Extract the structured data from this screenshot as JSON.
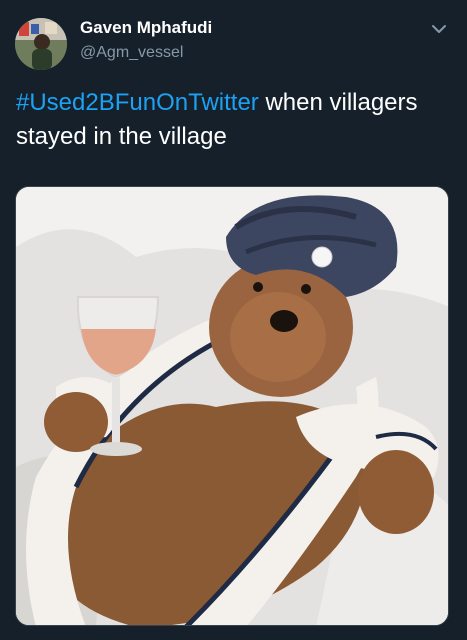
{
  "tweet": {
    "author_name": "Gaven Mphafudi",
    "author_handle": "@Agm_vessel",
    "hashtag": "#Used2BFunOnTwitter",
    "text": " when villagers stayed in the village"
  },
  "icons": {
    "menu": "chevron-down-icon"
  },
  "colors": {
    "background": "#15202b",
    "link": "#1da1f2",
    "secondary_text": "#8899a6"
  }
}
